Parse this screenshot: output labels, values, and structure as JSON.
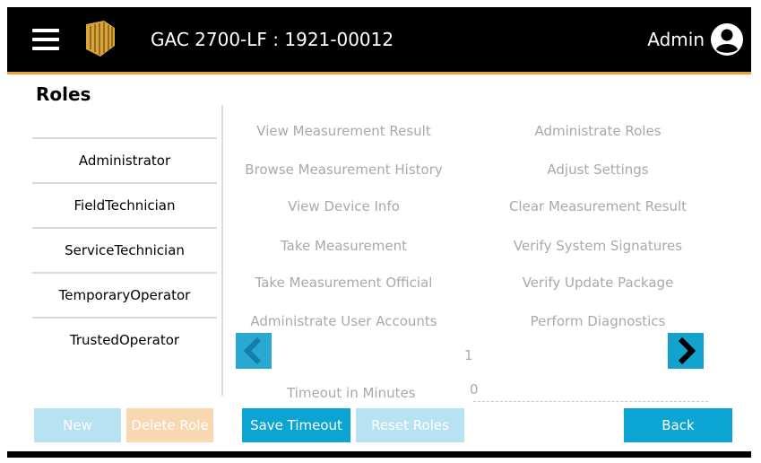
{
  "header": {
    "device_title": "GAC 2700-LF : 1921-00012",
    "user_name": "Admin",
    "menu_icon": "hamburger-menu-icon",
    "logo_icon": "company-logo-icon",
    "user_icon": "user-account-icon"
  },
  "colors": {
    "accent": "#f0a13e",
    "primary_button": "#0ca4d2",
    "disabled_button": "#b7e2f2",
    "disabled_delete": "#f9d7b1",
    "disabled_text": "#a9a9a9"
  },
  "page": {
    "title": "Roles"
  },
  "roles": [
    {
      "label": "Administrator"
    },
    {
      "label": "FieldTechnician"
    },
    {
      "label": "ServiceTechnician"
    },
    {
      "label": "TemporaryOperator"
    },
    {
      "label": "TrustedOperator"
    }
  ],
  "permissions": {
    "left": [
      "View Measurement Result",
      "Browse Measurement History",
      "View Device Info",
      "Take Measurement",
      "Take Measurement Official",
      "Administrate User Accounts"
    ],
    "right": [
      "Administrate Roles",
      "Adjust Settings",
      "Clear Measurement Result",
      "Verify System Signatures",
      "Verify Update Package",
      "Perform Diagnostics"
    ]
  },
  "pagination": {
    "page": "1",
    "prev_icon": "chevron-left-icon",
    "next_icon": "chevron-right-icon"
  },
  "timeout": {
    "label": "Timeout in Minutes",
    "value": "0"
  },
  "buttons": {
    "new": "New",
    "delete": "Delete Role",
    "save_timeout": "Save Timeout",
    "reset_roles": "Reset Roles",
    "back": "Back"
  }
}
